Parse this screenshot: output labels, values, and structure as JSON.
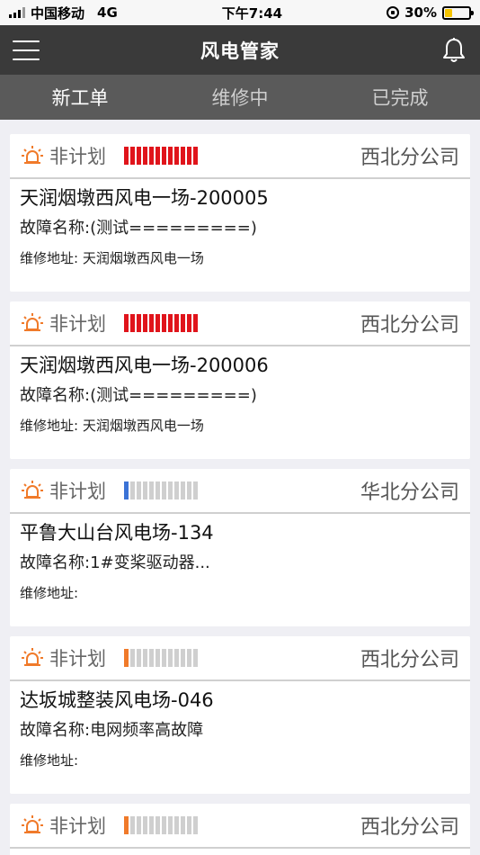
{
  "status_bar": {
    "carrier": "中国移动",
    "network": "4G",
    "time": "下午7:44",
    "battery": "30%",
    "battery_level": 0.3,
    "battery_color": "#f5c400"
  },
  "nav": {
    "title": "风电管家",
    "menu_icon": "hamburger-menu-icon",
    "bell_icon": "bell-icon"
  },
  "tabs": [
    {
      "label": "新工单",
      "active": true
    },
    {
      "label": "维修中",
      "active": false
    },
    {
      "label": "已完成",
      "active": false
    }
  ],
  "colors": {
    "alarm_orange": "#f07a2a",
    "bar_red": "#e0141b",
    "bar_blue": "#3b73d6",
    "bar_orange": "#f07a2a",
    "bar_empty": "#cfcfcf"
  },
  "orders": [
    {
      "type": "非计划",
      "priority_segments": 12,
      "priority_filled": 12,
      "priority_color": "#e0141b",
      "company": "西北分公司",
      "site": "天润烟墩西风电一场-200005",
      "fault_label": "故障名称:",
      "fault": "(测试=========)",
      "address_label": "维修地址: ",
      "address": "天润烟墩西风电一场"
    },
    {
      "type": "非计划",
      "priority_segments": 12,
      "priority_filled": 12,
      "priority_color": "#e0141b",
      "company": "西北分公司",
      "site": "天润烟墩西风电一场-200006",
      "fault_label": "故障名称:",
      "fault": "(测试=========)",
      "address_label": "维修地址: ",
      "address": "天润烟墩西风电一场"
    },
    {
      "type": "非计划",
      "priority_segments": 12,
      "priority_filled": 1,
      "priority_color": "#3b73d6",
      "company": "华北分公司",
      "site": "平鲁大山台风电场-134",
      "fault_label": "故障名称:",
      "fault": "1#变桨驱动器...",
      "address_label": "维修地址:",
      "address": ""
    },
    {
      "type": "非计划",
      "priority_segments": 12,
      "priority_filled": 1,
      "priority_color": "#f07a2a",
      "company": "西北分公司",
      "site": "达坂城整装风电场-046",
      "fault_label": "故障名称:",
      "fault": "电网频率高故障",
      "address_label": "维修地址:",
      "address": ""
    },
    {
      "type": "非计划",
      "priority_segments": 12,
      "priority_filled": 1,
      "priority_color": "#f07a2a",
      "company": "西北分公司"
    }
  ]
}
